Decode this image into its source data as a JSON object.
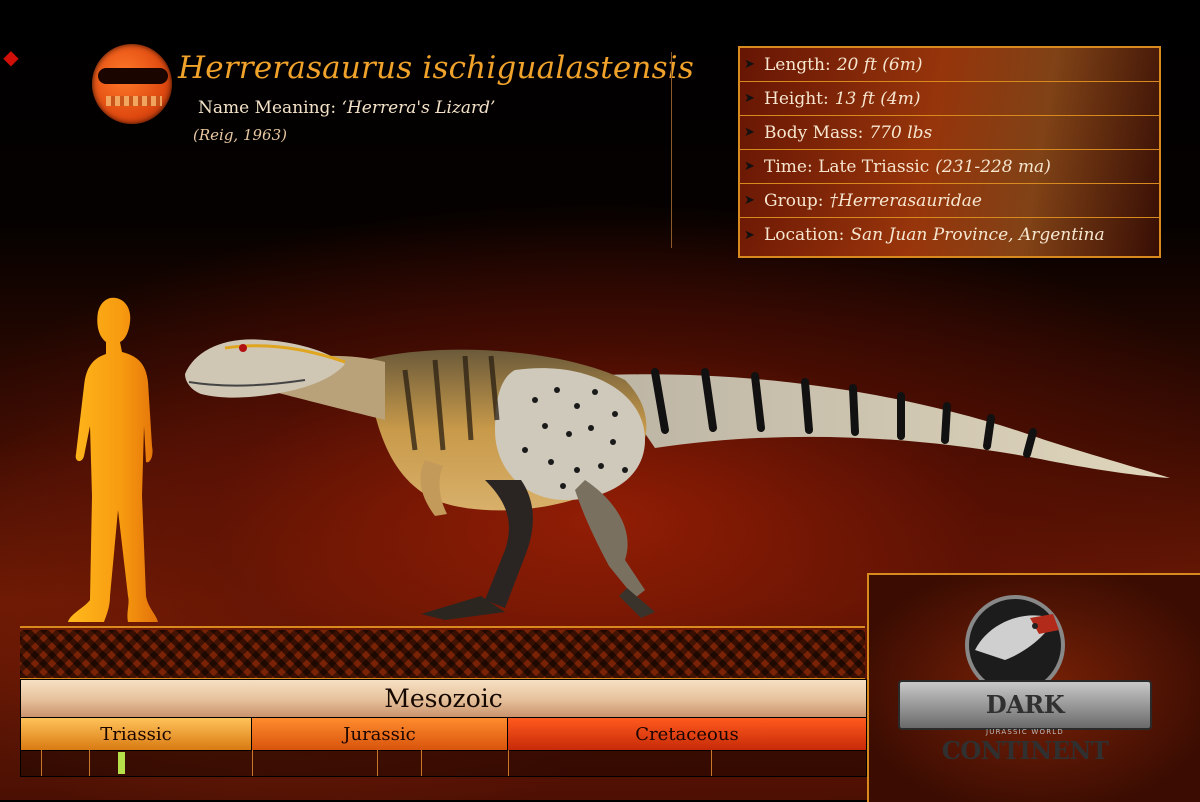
{
  "header": {
    "title": "Herrerasaurus ischigualastensis",
    "meaning_label": "Name Meaning: ",
    "meaning_value": "‘Herrera's Lizard’",
    "citation": "(Reig, 1963)"
  },
  "facts": [
    {
      "label": "Length:",
      "value": "20 ft (6m)"
    },
    {
      "label": "Height:",
      "value": "13 ft (4m)"
    },
    {
      "label": "Body Mass:",
      "value": "770 lbs"
    },
    {
      "label": "Time: Late Triassic",
      "value": "(231-228 ma)"
    },
    {
      "label": "Group:",
      "value": "†Herrerasauridae"
    },
    {
      "label": "Location:",
      "value": "San Juan Province, Argentina"
    }
  ],
  "timeline": {
    "era": "Mesozoic",
    "periods": [
      "Triassic",
      "Jurassic",
      "Cretaceous"
    ]
  },
  "brand": {
    "title": "DARK CONTINENT",
    "subtitle": "JURASSIC WORLD"
  },
  "colors": {
    "accent": "#d98a1f",
    "title": "#f0a22a",
    "human": "#f7a81c"
  },
  "icons": [
    "arrow-icon",
    "logo-icon",
    "emblem-icon"
  ]
}
